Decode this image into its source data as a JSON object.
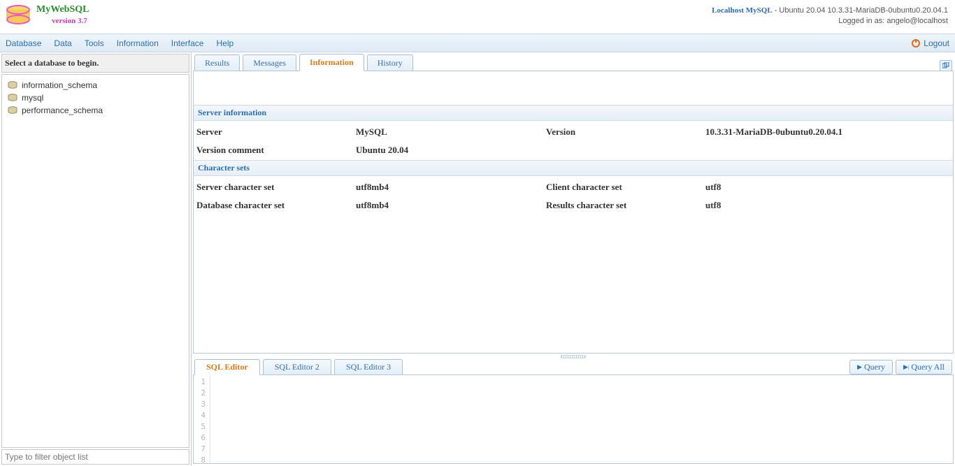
{
  "app": {
    "name": "MyWebSQL",
    "version": "version 3.7"
  },
  "connection": {
    "server_label": "Localhost MySQL",
    "server_detail": " - Ubuntu 20.04 10.3.31-MariaDB-0ubuntu0.20.04.1",
    "logged_in": "Logged in as: angelo@localhost"
  },
  "menu": {
    "items": [
      "Database",
      "Data",
      "Tools",
      "Information",
      "Interface",
      "Help"
    ],
    "logout": "Logout"
  },
  "sidebar": {
    "hint": "Select a database to begin.",
    "databases": [
      "information_schema",
      "mysql",
      "performance_schema"
    ],
    "filter_placeholder": "Type to filter object list"
  },
  "tabs": {
    "items": [
      "Results",
      "Messages",
      "Information",
      "History"
    ],
    "active": "Information"
  },
  "info": {
    "section1": "Server information",
    "server_lbl": "Server",
    "server_val": "MySQL",
    "version_lbl": "Version",
    "version_val": "10.3.31-MariaDB-0ubuntu0.20.04.1",
    "vcomment_lbl": "Version comment",
    "vcomment_val": "Ubuntu 20.04",
    "section2": "Character sets",
    "scs_lbl": "Server character set",
    "scs_val": "utf8mb4",
    "ccs_lbl": "Client character set",
    "ccs_val": "utf8",
    "dcs_lbl": "Database character set",
    "dcs_val": "utf8mb4",
    "rcs_lbl": "Results character set",
    "rcs_val": "utf8"
  },
  "editor": {
    "tabs": [
      "SQL Editor",
      "SQL Editor 2",
      "SQL Editor 3"
    ],
    "active": "SQL Editor",
    "query_btn": "Query",
    "query_all_btn": "Query All",
    "lines": [
      "1",
      "2",
      "3",
      "4",
      "5",
      "6",
      "7",
      "8"
    ]
  }
}
